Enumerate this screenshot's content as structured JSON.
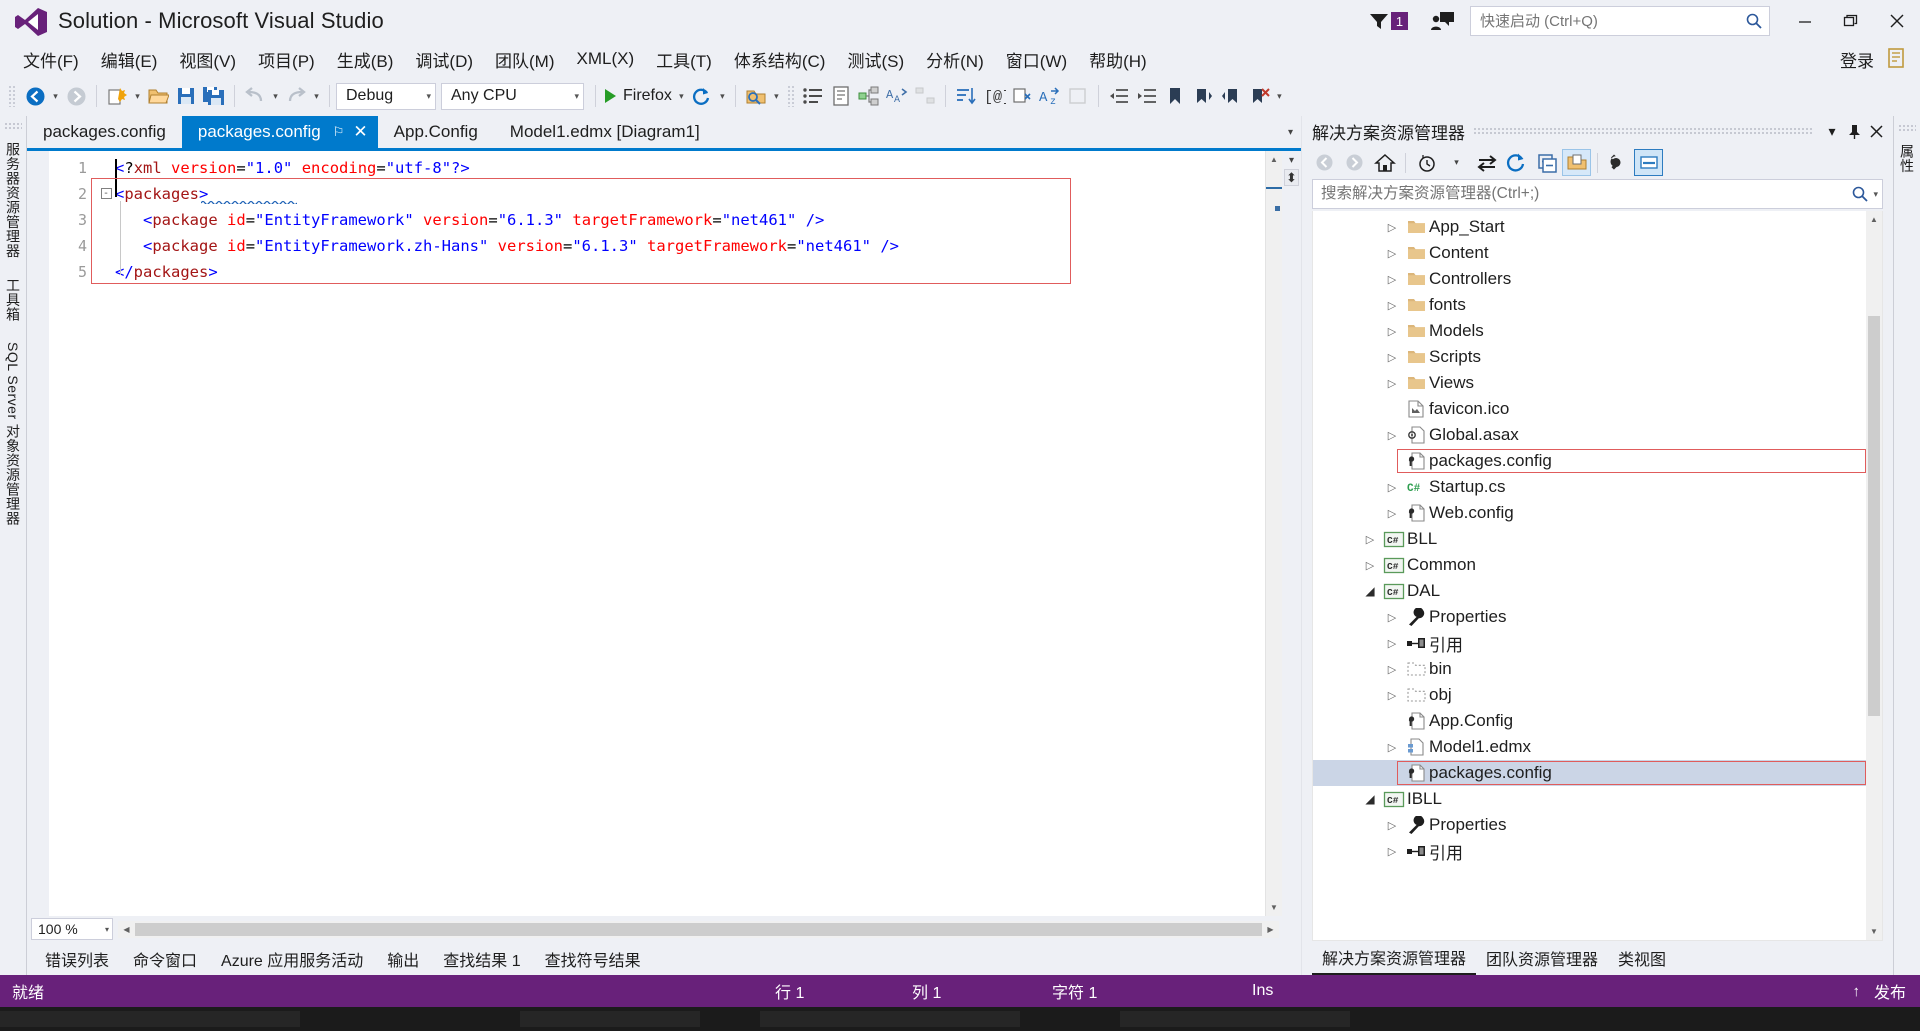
{
  "window": {
    "title": "Solution - Microsoft Visual Studio",
    "logo_name": "visual-studio-logo",
    "minimize": "–",
    "maximize": "❐",
    "close": "✕"
  },
  "titlebar": {
    "notification_count": "1",
    "quick_launch_placeholder": "快速启动 (Ctrl+Q)",
    "quick_launch_value": ""
  },
  "menubar": {
    "items": [
      "文件(F)",
      "编辑(E)",
      "视图(V)",
      "项目(P)",
      "生成(B)",
      "调试(D)",
      "团队(M)",
      "XML(X)",
      "工具(T)",
      "体系结构(C)",
      "测试(S)",
      "分析(N)",
      "窗口(W)",
      "帮助(H)"
    ],
    "signin": "登录"
  },
  "toolbar": {
    "configuration": "Debug",
    "platform": "Any CPU",
    "run_target": "Firefox",
    "icons": [
      "navigate-back-icon",
      "navigate-forward-icon",
      "new-project-icon",
      "open-file-icon",
      "save-icon",
      "save-all-icon",
      "undo-icon",
      "redo-icon"
    ]
  },
  "editor": {
    "tabs": [
      {
        "label": "packages.config",
        "active": false,
        "closable": false
      },
      {
        "label": "packages.config",
        "active": true,
        "closable": true
      },
      {
        "label": "App.Config",
        "active": false,
        "closable": false
      },
      {
        "label": "Model1.edmx [Diagram1]",
        "active": false,
        "closable": false
      }
    ],
    "pin_glyph": "⚐",
    "close_glyph": "✕",
    "zoom_level": "100 %",
    "lines": [
      {
        "n": "1",
        "indent": 0,
        "fold": "",
        "text": "<?xml version=\"1.0\" encoding=\"utf-8\"?>"
      },
      {
        "n": "2",
        "indent": 0,
        "fold": "-",
        "text": "<packages>"
      },
      {
        "n": "3",
        "indent": 1,
        "fold": "",
        "text": "<package id=\"EntityFramework\" version=\"6.1.3\" targetFramework=\"net461\" />"
      },
      {
        "n": "4",
        "indent": 1,
        "fold": "",
        "text": "<package id=\"EntityFramework.zh-Hans\" version=\"6.1.3\" targetFramework=\"net461\" />"
      },
      {
        "n": "5",
        "indent": 0,
        "fold": "",
        "text": "</packages>"
      }
    ]
  },
  "bottom_tabs": [
    "错误列表",
    "命令窗口",
    "Azure 应用服务活动",
    "输出",
    "查找结果 1",
    "查找符号结果"
  ],
  "left_dock": {
    "tabs": [
      "服务器资源管理器",
      "工具箱",
      "SQL Server 对象资源管理器"
    ]
  },
  "right_dock": {
    "tabs": [
      "属性"
    ]
  },
  "solution_explorer": {
    "title": "解决方案资源管理器",
    "header_buttons": [
      "chevron-down-icon",
      "pin-icon",
      "close-icon"
    ],
    "search_placeholder": "搜索解决方案资源管理器(Ctrl+;)",
    "search_value": "",
    "toolbar_icons": [
      "back-icon",
      "forward-icon",
      "home-icon",
      "pending-changes-icon",
      "sync-with-active-document-icon",
      "refresh-icon",
      "collapse-all-icon",
      "show-all-files-icon",
      "properties-icon",
      "preview-selected-items-icon"
    ],
    "tree": [
      {
        "indent": 2,
        "arrow": "closed",
        "icon": "folder-icon",
        "label": "App_Start",
        "selected": false,
        "highlight": false
      },
      {
        "indent": 2,
        "arrow": "closed",
        "icon": "folder-icon",
        "label": "Content",
        "selected": false,
        "highlight": false
      },
      {
        "indent": 2,
        "arrow": "closed",
        "icon": "folder-icon",
        "label": "Controllers",
        "selected": false,
        "highlight": false
      },
      {
        "indent": 2,
        "arrow": "closed",
        "icon": "folder-icon",
        "label": "fonts",
        "selected": false,
        "highlight": false
      },
      {
        "indent": 2,
        "arrow": "closed",
        "icon": "folder-icon",
        "label": "Models",
        "selected": false,
        "highlight": false
      },
      {
        "indent": 2,
        "arrow": "closed",
        "icon": "folder-icon",
        "label": "Scripts",
        "selected": false,
        "highlight": false
      },
      {
        "indent": 2,
        "arrow": "closed",
        "icon": "folder-icon",
        "label": "Views",
        "selected": false,
        "highlight": false
      },
      {
        "indent": 2,
        "arrow": "none",
        "icon": "image-file-icon",
        "label": "favicon.ico",
        "selected": false,
        "highlight": false
      },
      {
        "indent": 2,
        "arrow": "closed",
        "icon": "asax-file-icon",
        "label": "Global.asax",
        "selected": false,
        "highlight": false
      },
      {
        "indent": 2,
        "arrow": "none",
        "icon": "config-file-icon",
        "label": "packages.config",
        "selected": false,
        "highlight": true
      },
      {
        "indent": 2,
        "arrow": "closed",
        "icon": "csharp-file-icon",
        "label": "Startup.cs",
        "selected": false,
        "highlight": false
      },
      {
        "indent": 2,
        "arrow": "closed",
        "icon": "config-file-icon",
        "label": "Web.config",
        "selected": false,
        "highlight": false
      },
      {
        "indent": 1,
        "arrow": "closed",
        "icon": "csharp-project-icon",
        "label": "BLL",
        "selected": false,
        "highlight": false
      },
      {
        "indent": 1,
        "arrow": "closed",
        "icon": "csharp-project-icon",
        "label": "Common",
        "selected": false,
        "highlight": false
      },
      {
        "indent": 1,
        "arrow": "open",
        "icon": "csharp-project-icon",
        "label": "DAL",
        "selected": false,
        "highlight": false
      },
      {
        "indent": 2,
        "arrow": "closed",
        "icon": "wrench-icon",
        "label": "Properties",
        "selected": false,
        "highlight": false
      },
      {
        "indent": 2,
        "arrow": "closed",
        "icon": "references-icon",
        "label": "引用",
        "selected": false,
        "highlight": false
      },
      {
        "indent": 2,
        "arrow": "closed",
        "icon": "hidden-folder-icon",
        "label": "bin",
        "selected": false,
        "highlight": false
      },
      {
        "indent": 2,
        "arrow": "closed",
        "icon": "hidden-folder-icon",
        "label": "obj",
        "selected": false,
        "highlight": false
      },
      {
        "indent": 2,
        "arrow": "none",
        "icon": "config-file-icon",
        "label": "App.Config",
        "selected": false,
        "highlight": false
      },
      {
        "indent": 2,
        "arrow": "closed",
        "icon": "edmx-file-icon",
        "label": "Model1.edmx",
        "selected": false,
        "highlight": false
      },
      {
        "indent": 2,
        "arrow": "none",
        "icon": "config-file-icon",
        "label": "packages.config",
        "selected": true,
        "highlight": true
      },
      {
        "indent": 1,
        "arrow": "open",
        "icon": "csharp-project-icon",
        "label": "IBLL",
        "selected": false,
        "highlight": false
      },
      {
        "indent": 2,
        "arrow": "closed",
        "icon": "wrench-icon",
        "label": "Properties",
        "selected": false,
        "highlight": false
      },
      {
        "indent": 2,
        "arrow": "closed",
        "icon": "references-icon",
        "label": "引用",
        "selected": false,
        "highlight": false
      }
    ],
    "footer_tabs": [
      {
        "label": "解决方案资源管理器",
        "active": true
      },
      {
        "label": "团队资源管理器",
        "active": false
      },
      {
        "label": "类视图",
        "active": false
      }
    ]
  },
  "statusbar": {
    "status": "就绪",
    "line_label": "行 1",
    "col_label": "列 1",
    "char_label": "字符 1",
    "insert_mode": "Ins",
    "publish": "发布",
    "up_glyph": "↑",
    "background": "#68217a"
  },
  "colors": {
    "accent_purple": "#68217a",
    "accent_blue": "#007acc",
    "chrome": "#eef0f5",
    "editor_bg": "#ffffff",
    "xml_tag": "#a31515",
    "xml_attr": "#ff0000",
    "xml_value": "#0000ff",
    "highlight_box": "#e05c5c"
  }
}
